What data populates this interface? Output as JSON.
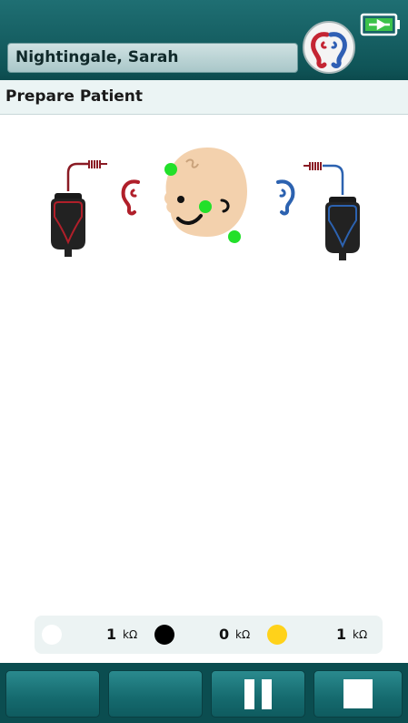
{
  "header": {
    "patient_name": "Nightingale, Sarah"
  },
  "subheader": {
    "title": "Prepare Patient"
  },
  "colors": {
    "header_teal": "#0f5457",
    "left_ear_red": "#b01f2a",
    "right_ear_blue": "#2c62b0",
    "electrode_ok_green": "#22e02a",
    "skin": "#f3d1ad"
  },
  "impedance": {
    "items": [
      {
        "electrode": "white",
        "color": "#ffffff",
        "value": "1",
        "unit": "kΩ"
      },
      {
        "electrode": "black",
        "color": "#000000",
        "value": "0",
        "unit": "kΩ"
      },
      {
        "electrode": "yellow",
        "color": "#ffd21a",
        "value": "1",
        "unit": "kΩ"
      }
    ]
  },
  "toolbar": {
    "buttons": [
      {
        "name": "blank-button-1",
        "icon": ""
      },
      {
        "name": "blank-button-2",
        "icon": ""
      },
      {
        "name": "pause-button",
        "icon": "pause-icon"
      },
      {
        "name": "stop-button",
        "icon": "stop-icon"
      }
    ]
  }
}
